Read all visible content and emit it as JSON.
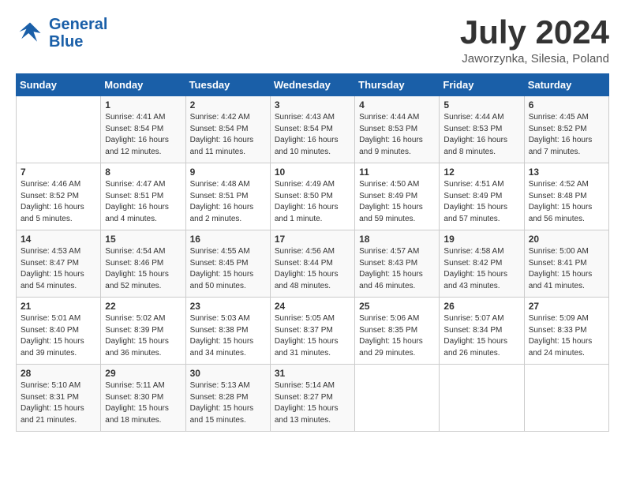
{
  "header": {
    "logo_line1": "General",
    "logo_line2": "Blue",
    "month": "July 2024",
    "location": "Jaworzynka, Silesia, Poland"
  },
  "weekdays": [
    "Sunday",
    "Monday",
    "Tuesday",
    "Wednesday",
    "Thursday",
    "Friday",
    "Saturday"
  ],
  "weeks": [
    [
      {
        "day": "",
        "info": ""
      },
      {
        "day": "1",
        "info": "Sunrise: 4:41 AM\nSunset: 8:54 PM\nDaylight: 16 hours\nand 12 minutes."
      },
      {
        "day": "2",
        "info": "Sunrise: 4:42 AM\nSunset: 8:54 PM\nDaylight: 16 hours\nand 11 minutes."
      },
      {
        "day": "3",
        "info": "Sunrise: 4:43 AM\nSunset: 8:54 PM\nDaylight: 16 hours\nand 10 minutes."
      },
      {
        "day": "4",
        "info": "Sunrise: 4:44 AM\nSunset: 8:53 PM\nDaylight: 16 hours\nand 9 minutes."
      },
      {
        "day": "5",
        "info": "Sunrise: 4:44 AM\nSunset: 8:53 PM\nDaylight: 16 hours\nand 8 minutes."
      },
      {
        "day": "6",
        "info": "Sunrise: 4:45 AM\nSunset: 8:52 PM\nDaylight: 16 hours\nand 7 minutes."
      }
    ],
    [
      {
        "day": "7",
        "info": "Sunrise: 4:46 AM\nSunset: 8:52 PM\nDaylight: 16 hours\nand 5 minutes."
      },
      {
        "day": "8",
        "info": "Sunrise: 4:47 AM\nSunset: 8:51 PM\nDaylight: 16 hours\nand 4 minutes."
      },
      {
        "day": "9",
        "info": "Sunrise: 4:48 AM\nSunset: 8:51 PM\nDaylight: 16 hours\nand 2 minutes."
      },
      {
        "day": "10",
        "info": "Sunrise: 4:49 AM\nSunset: 8:50 PM\nDaylight: 16 hours\nand 1 minute."
      },
      {
        "day": "11",
        "info": "Sunrise: 4:50 AM\nSunset: 8:49 PM\nDaylight: 15 hours\nand 59 minutes."
      },
      {
        "day": "12",
        "info": "Sunrise: 4:51 AM\nSunset: 8:49 PM\nDaylight: 15 hours\nand 57 minutes."
      },
      {
        "day": "13",
        "info": "Sunrise: 4:52 AM\nSunset: 8:48 PM\nDaylight: 15 hours\nand 56 minutes."
      }
    ],
    [
      {
        "day": "14",
        "info": "Sunrise: 4:53 AM\nSunset: 8:47 PM\nDaylight: 15 hours\nand 54 minutes."
      },
      {
        "day": "15",
        "info": "Sunrise: 4:54 AM\nSunset: 8:46 PM\nDaylight: 15 hours\nand 52 minutes."
      },
      {
        "day": "16",
        "info": "Sunrise: 4:55 AM\nSunset: 8:45 PM\nDaylight: 15 hours\nand 50 minutes."
      },
      {
        "day": "17",
        "info": "Sunrise: 4:56 AM\nSunset: 8:44 PM\nDaylight: 15 hours\nand 48 minutes."
      },
      {
        "day": "18",
        "info": "Sunrise: 4:57 AM\nSunset: 8:43 PM\nDaylight: 15 hours\nand 46 minutes."
      },
      {
        "day": "19",
        "info": "Sunrise: 4:58 AM\nSunset: 8:42 PM\nDaylight: 15 hours\nand 43 minutes."
      },
      {
        "day": "20",
        "info": "Sunrise: 5:00 AM\nSunset: 8:41 PM\nDaylight: 15 hours\nand 41 minutes."
      }
    ],
    [
      {
        "day": "21",
        "info": "Sunrise: 5:01 AM\nSunset: 8:40 PM\nDaylight: 15 hours\nand 39 minutes."
      },
      {
        "day": "22",
        "info": "Sunrise: 5:02 AM\nSunset: 8:39 PM\nDaylight: 15 hours\nand 36 minutes."
      },
      {
        "day": "23",
        "info": "Sunrise: 5:03 AM\nSunset: 8:38 PM\nDaylight: 15 hours\nand 34 minutes."
      },
      {
        "day": "24",
        "info": "Sunrise: 5:05 AM\nSunset: 8:37 PM\nDaylight: 15 hours\nand 31 minutes."
      },
      {
        "day": "25",
        "info": "Sunrise: 5:06 AM\nSunset: 8:35 PM\nDaylight: 15 hours\nand 29 minutes."
      },
      {
        "day": "26",
        "info": "Sunrise: 5:07 AM\nSunset: 8:34 PM\nDaylight: 15 hours\nand 26 minutes."
      },
      {
        "day": "27",
        "info": "Sunrise: 5:09 AM\nSunset: 8:33 PM\nDaylight: 15 hours\nand 24 minutes."
      }
    ],
    [
      {
        "day": "28",
        "info": "Sunrise: 5:10 AM\nSunset: 8:31 PM\nDaylight: 15 hours\nand 21 minutes."
      },
      {
        "day": "29",
        "info": "Sunrise: 5:11 AM\nSunset: 8:30 PM\nDaylight: 15 hours\nand 18 minutes."
      },
      {
        "day": "30",
        "info": "Sunrise: 5:13 AM\nSunset: 8:28 PM\nDaylight: 15 hours\nand 15 minutes."
      },
      {
        "day": "31",
        "info": "Sunrise: 5:14 AM\nSunset: 8:27 PM\nDaylight: 15 hours\nand 13 minutes."
      },
      {
        "day": "",
        "info": ""
      },
      {
        "day": "",
        "info": ""
      },
      {
        "day": "",
        "info": ""
      }
    ]
  ]
}
